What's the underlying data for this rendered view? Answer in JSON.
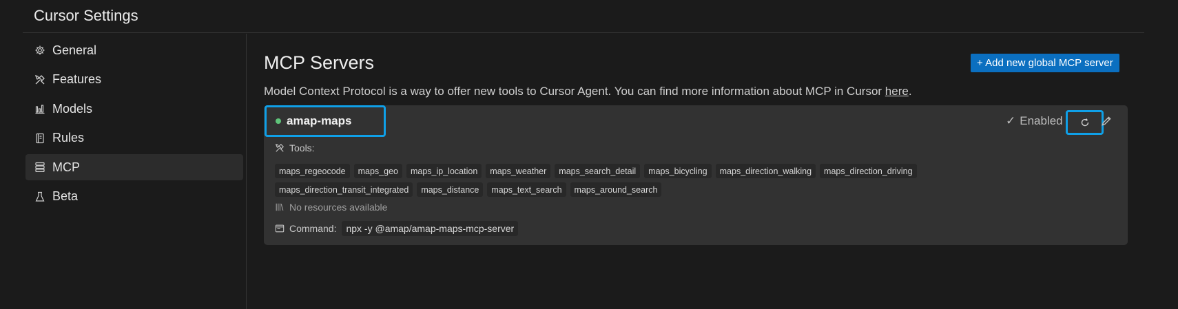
{
  "window": {
    "title": "Cursor Settings"
  },
  "sidebar": {
    "items": [
      {
        "label": "General",
        "icon": "gear-icon",
        "active": false
      },
      {
        "label": "Features",
        "icon": "tools-icon",
        "active": false
      },
      {
        "label": "Models",
        "icon": "bar-chart-icon",
        "active": false
      },
      {
        "label": "Rules",
        "icon": "book-icon",
        "active": false
      },
      {
        "label": "MCP",
        "icon": "server-icon",
        "active": true
      },
      {
        "label": "Beta",
        "icon": "flask-icon",
        "active": false
      }
    ]
  },
  "main": {
    "title": "MCP Servers",
    "add_button_label": "+ Add new global MCP server",
    "description_prefix": "Model Context Protocol is a way to offer new tools to Cursor Agent. You can find more information about MCP in Cursor ",
    "description_link": "here",
    "description_suffix": ".",
    "server": {
      "name": "amap-maps",
      "status_color": "#5fc47a",
      "enabled_label": "Enabled",
      "tools_label": "Tools:",
      "tools_row1": [
        "maps_regeocode",
        "maps_geo",
        "maps_ip_location",
        "maps_weather",
        "maps_search_detail",
        "maps_bicycling",
        "maps_direction_walking",
        "maps_direction_driving"
      ],
      "tools_row2": [
        "maps_direction_transit_integrated",
        "maps_distance",
        "maps_text_search",
        "maps_around_search"
      ],
      "resources_label": "No resources available",
      "command_label": "Command:",
      "command_value": "npx -y @amap/amap-maps-mcp-server"
    }
  },
  "colors": {
    "accent": "#0b6fc0",
    "highlight": "#0fa0e8"
  }
}
